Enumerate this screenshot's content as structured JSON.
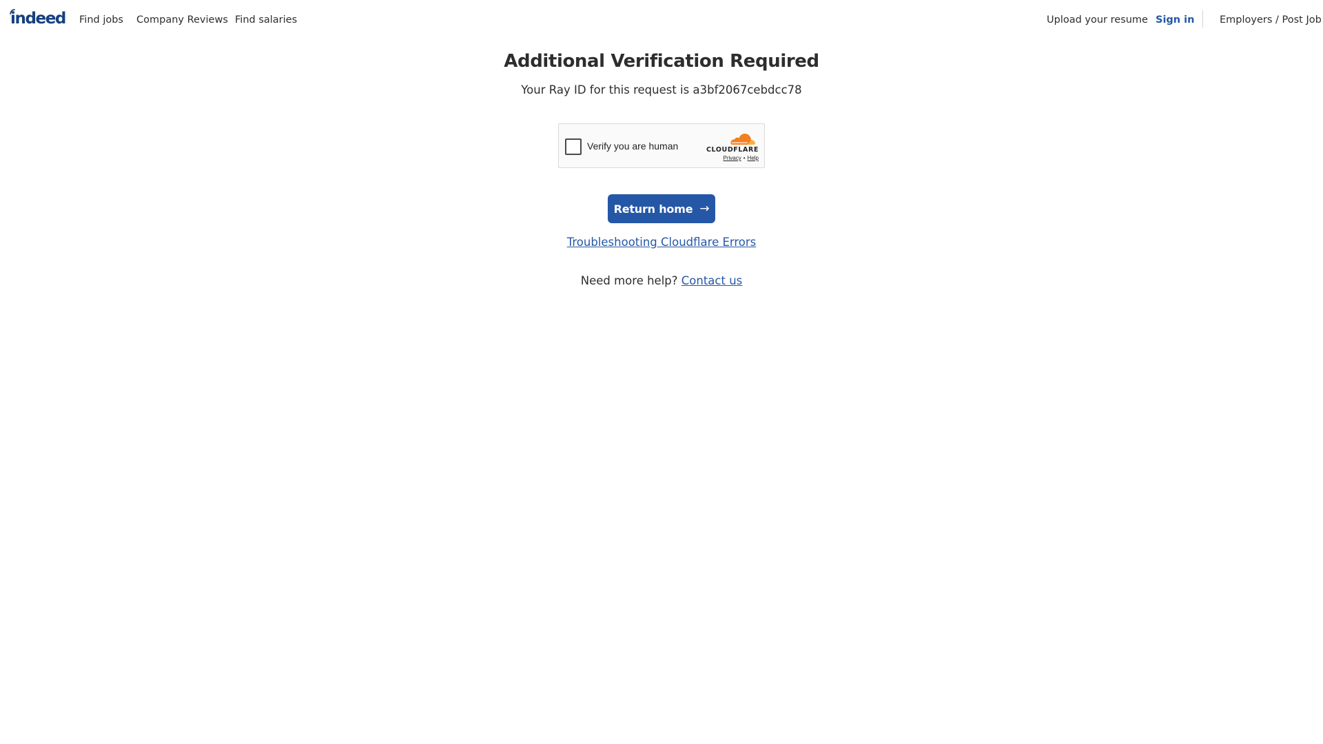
{
  "header": {
    "logo_text": "indeed",
    "nav_left": {
      "find_jobs": "Find jobs",
      "company_reviews": "Company Reviews",
      "find_salaries": "Find salaries"
    },
    "nav_right": {
      "upload_resume": "Upload your resume",
      "sign_in": "Sign in",
      "employers": "Employers / Post Job"
    }
  },
  "main": {
    "title": "Additional Verification Required",
    "ray_id_text": "Your Ray ID for this request is a3bf2067cebdcc78",
    "captcha": {
      "label": "Verify you are human",
      "brand": "CLOUDFLARE",
      "privacy_link": "Privacy",
      "separator": "•",
      "help_link": "Help",
      "cloud_color": "#f38020"
    },
    "return_button": {
      "label": "Return home",
      "arrow": "→"
    },
    "troubleshoot_link": "Troubleshooting Cloudflare Errors",
    "help_prefix": "Need more help?",
    "contact_link": "Contact us"
  },
  "colors": {
    "brand": "#2557a7",
    "logo": "#164081",
    "text": "#2d2d2d"
  }
}
